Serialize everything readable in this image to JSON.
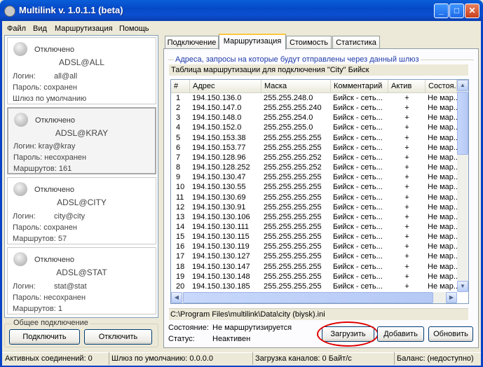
{
  "window": {
    "title": "Multilink v. 1.0.1.1 (beta)",
    "minimize": "_",
    "maximize": "□",
    "close": "✕"
  },
  "menu": [
    "Файл",
    "Вид",
    "Маршрутизация",
    "Помощь"
  ],
  "connections": [
    {
      "state": "Отключено",
      "name": "ADSL@ALL",
      "lines": [
        [
          "Логин:",
          "all@all"
        ],
        [
          "Пароль: сохранен",
          ""
        ],
        [
          "Шлюз по умолчанию",
          ""
        ]
      ]
    },
    {
      "state": "Отключено",
      "name": "ADSL@KRAY",
      "lines": [
        [
          "Логин: kray@kray",
          ""
        ],
        [
          "Пароль: несохранен",
          ""
        ],
        [
          "Маршрутов: 161",
          ""
        ]
      ]
    },
    {
      "state": "Отключено",
      "name": "ADSL@CITY",
      "lines": [
        [
          "Логин:",
          "city@city"
        ],
        [
          "Пароль: сохранен",
          ""
        ],
        [
          "Маршрутов: 57",
          ""
        ]
      ]
    },
    {
      "state": "Отключено",
      "name": "ADSL@STAT",
      "lines": [
        [
          "Логин:",
          "stat@stat"
        ],
        [
          "Пароль: несохранен",
          ""
        ],
        [
          "Маршрутов: 1",
          ""
        ]
      ]
    }
  ],
  "general": {
    "title": "Общее подключение",
    "connect": "Подключить",
    "disconnect": "Отключить"
  },
  "tabs": [
    "Подключение",
    "Маршрутизация",
    "Стоимость",
    "Статистика"
  ],
  "routes": {
    "legend": "Адреса, запросы на которые будут отправлены через данный шлюз",
    "caption": "Таблица маршрутизации для подключения \"City\" Бийск",
    "columns": [
      "#",
      "Адрес",
      "Маска",
      "Комментарий",
      "Актив",
      "Состоя..."
    ],
    "rows": [
      [
        "1",
        "194.150.136.0",
        "255.255.248.0",
        "Бийск - сеть...",
        "+",
        "Не мар..."
      ],
      [
        "2",
        "194.150.147.0",
        "255.255.255.240",
        "Бийск - сеть...",
        "+",
        "Не мар..."
      ],
      [
        "3",
        "194.150.148.0",
        "255.255.254.0",
        "Бийск - сеть...",
        "+",
        "Не мар..."
      ],
      [
        "4",
        "194.150.152.0",
        "255.255.255.0",
        "Бийск - сеть...",
        "+",
        "Не мар..."
      ],
      [
        "5",
        "194.150.153.38",
        "255.255.255.255",
        "Бийск - сеть...",
        "+",
        "Не мар..."
      ],
      [
        "6",
        "194.150.153.77",
        "255.255.255.255",
        "Бийск - сеть...",
        "+",
        "Не мар..."
      ],
      [
        "7",
        "194.150.128.96",
        "255.255.255.252",
        "Бийск - сеть...",
        "+",
        "Не мар..."
      ],
      [
        "8",
        "194.150.128.252",
        "255.255.255.252",
        "Бийск - сеть...",
        "+",
        "Не мар..."
      ],
      [
        "9",
        "194.150.130.47",
        "255.255.255.255",
        "Бийск - сеть...",
        "+",
        "Не мар..."
      ],
      [
        "10",
        "194.150.130.55",
        "255.255.255.255",
        "Бийск - сеть...",
        "+",
        "Не мар..."
      ],
      [
        "11",
        "194.150.130.69",
        "255.255.255.255",
        "Бийск - сеть...",
        "+",
        "Не мар..."
      ],
      [
        "12",
        "194.150.130.91",
        "255.255.255.255",
        "Бийск - сеть...",
        "+",
        "Не мар..."
      ],
      [
        "13",
        "194.150.130.106",
        "255.255.255.255",
        "Бийск - сеть...",
        "+",
        "Не мар..."
      ],
      [
        "14",
        "194.150.130.111",
        "255.255.255.255",
        "Бийск - сеть...",
        "+",
        "Не мар..."
      ],
      [
        "15",
        "194.150.130.115",
        "255.255.255.255",
        "Бийск - сеть...",
        "+",
        "Не мар..."
      ],
      [
        "16",
        "194.150.130.119",
        "255.255.255.255",
        "Бийск - сеть...",
        "+",
        "Не мар..."
      ],
      [
        "17",
        "194.150.130.127",
        "255.255.255.255",
        "Бийск - сеть...",
        "+",
        "Не мар..."
      ],
      [
        "18",
        "194.150.130.147",
        "255.255.255.255",
        "Бийск - сеть...",
        "+",
        "Не мар..."
      ],
      [
        "19",
        "194.150.130.148",
        "255.255.255.255",
        "Бийск - сеть...",
        "+",
        "Не мар..."
      ],
      [
        "20",
        "194.150.130.185",
        "255.255.255.255",
        "Бийск - сеть...",
        "+",
        "Не мар..."
      ]
    ],
    "path": "C:\\Program Files\\multilink\\Data\\city (biysk).ini",
    "state_label": "Состояние:",
    "state_value": "Не маршрутизируется",
    "status_label": "Статус:",
    "status_value": "Неактивен",
    "load": "Загрузить",
    "add": "Добавить",
    "refresh": "Обновить",
    "highlight_color": "#e00000"
  },
  "statusbar": {
    "active": "Активных соединений: 0",
    "gateway": "Шлюз по умолчанию: 0.0.0.0",
    "load": "Загрузка каналов: 0 Байт/с",
    "balance": "Баланс: (недоступно)"
  }
}
